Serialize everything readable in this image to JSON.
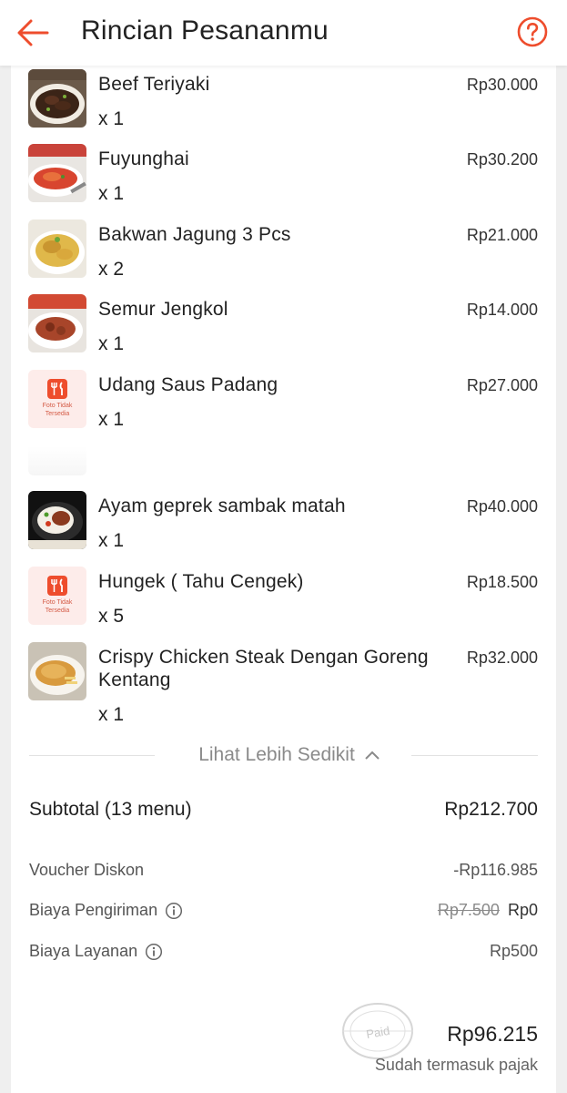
{
  "header": {
    "title": "Rincian Pesananmu",
    "back_icon": "arrow-left-icon",
    "help_icon": "question-circle-icon",
    "accent_color": "#ee4d2d"
  },
  "items": [
    {
      "name": "Beef Teriyaki",
      "qty": "x 1",
      "price": "Rp30.000",
      "thumb": "beef-teriyaki-photo"
    },
    {
      "name": "Fuyunghai",
      "qty": "x 1",
      "price": "Rp30.200",
      "thumb": "fuyunghai-photo"
    },
    {
      "name": "Bakwan Jagung 3 Pcs",
      "qty": "x 2",
      "price": "Rp21.000",
      "thumb": "bakwan-jagung-photo"
    },
    {
      "name": "Semur Jengkol",
      "qty": "x 1",
      "price": "Rp14.000",
      "thumb": "semur-jengkol-photo"
    },
    {
      "name": "Udang Saus Padang",
      "qty": "x 1",
      "price": "Rp27.000",
      "thumb": "no-photo-placeholder",
      "placeholder_text": "Foto Tidak Tersedia"
    },
    {
      "name": "Ayam geprek sambak matah",
      "qty": "x 1",
      "price": "Rp40.000",
      "thumb": "ayam-geprek-photo"
    },
    {
      "name": "Hungek ( Tahu Cengek)",
      "qty": "x 5",
      "price": "Rp18.500",
      "thumb": "no-photo-placeholder",
      "placeholder_text": "Foto Tidak Tersedia"
    },
    {
      "name": "Crispy Chicken Steak Dengan Goreng Kentang",
      "qty": "x 1",
      "price": "Rp32.000",
      "thumb": "crispy-chicken-steak-photo"
    }
  ],
  "see_less": {
    "label": "Lihat Lebih Sedikit",
    "icon": "chevron-up-icon"
  },
  "summary": {
    "subtotal_label": "Subtotal (13 menu)",
    "subtotal_value": "Rp212.700",
    "voucher_label": "Voucher Diskon",
    "voucher_value": "-Rp116.985",
    "shipping_label": "Biaya Pengiriman",
    "shipping_original": "Rp7.500",
    "shipping_value": "Rp0",
    "service_label": "Biaya Layanan",
    "service_value": "Rp500",
    "info_icon": "info-circle-icon",
    "total_value": "Rp96.215",
    "tax_note": "Sudah termasuk pajak",
    "stamp_text": "Paid"
  }
}
